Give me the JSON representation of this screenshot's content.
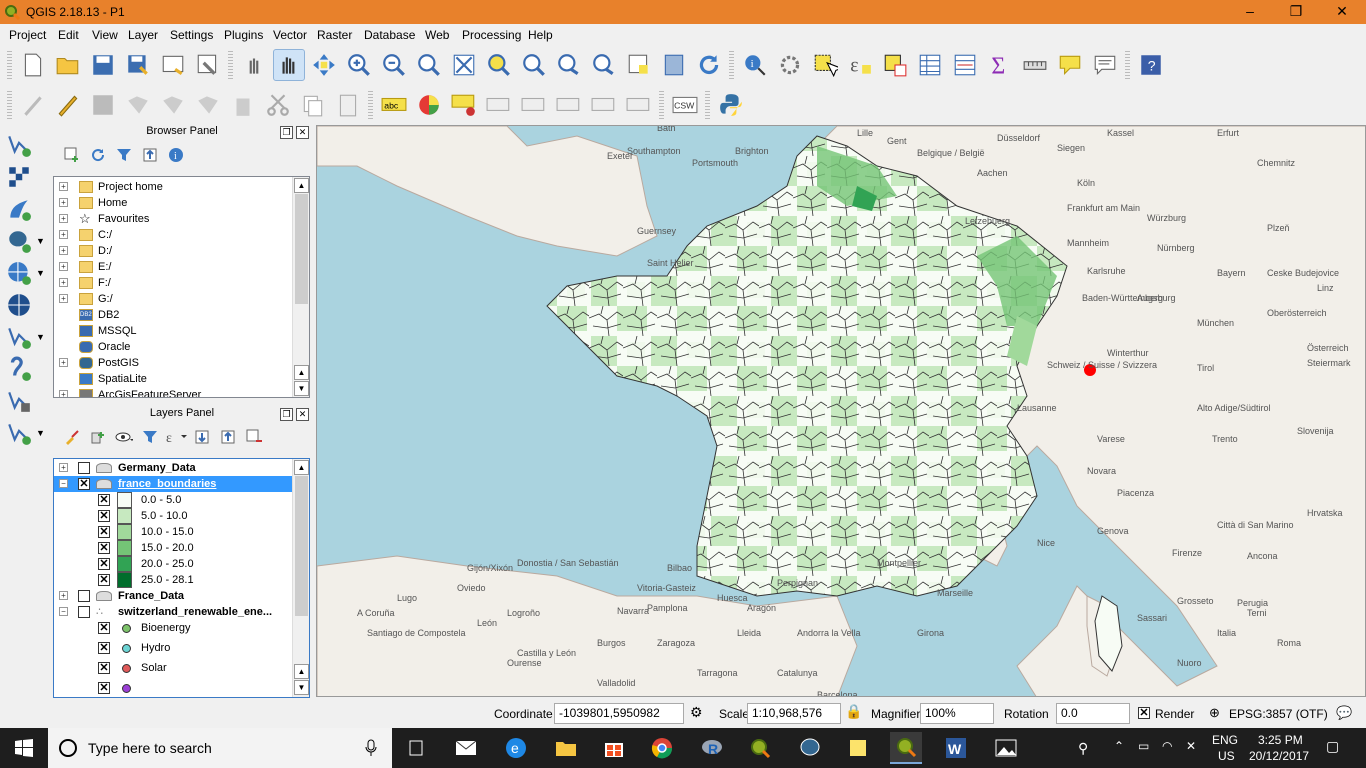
{
  "window": {
    "title": "QGIS 2.18.13 - P1",
    "minimize": "–",
    "maximize": "❐",
    "close": "✕"
  },
  "menu": [
    "Project",
    "Edit",
    "View",
    "Layer",
    "Settings",
    "Plugins",
    "Vector",
    "Raster",
    "Database",
    "Web",
    "Processing",
    "Help"
  ],
  "toolbar_row2": {
    "abc_label": "abc",
    "csw_label": "CSW"
  },
  "browser_panel": {
    "title": "Browser Panel",
    "items": [
      {
        "label": "Project home",
        "icon": "folder-icon"
      },
      {
        "label": "Home",
        "icon": "folder-icon"
      },
      {
        "label": "Favourites",
        "icon": "star-icon"
      },
      {
        "label": "C:/",
        "icon": "folder-icon"
      },
      {
        "label": "D:/",
        "icon": "folder-icon"
      },
      {
        "label": "E:/",
        "icon": "folder-icon"
      },
      {
        "label": "F:/",
        "icon": "folder-icon"
      },
      {
        "label": "G:/",
        "icon": "folder-icon"
      },
      {
        "label": "DB2",
        "icon": "db2-icon",
        "badge": "DB2"
      },
      {
        "label": "MSSQL",
        "icon": "mssql-icon"
      },
      {
        "label": "Oracle",
        "icon": "oracle-icon"
      },
      {
        "label": "PostGIS",
        "icon": "postgis-icon"
      },
      {
        "label": "SpatiaLite",
        "icon": "spatialite-icon"
      },
      {
        "label": "ArcGisFeatureServer",
        "icon": "arcgis-icon"
      }
    ]
  },
  "layers_panel": {
    "title": "Layers Panel",
    "layers": [
      {
        "label": "Germany_Data",
        "checked": false,
        "expanded": false
      },
      {
        "label": "france_boundaries",
        "checked": true,
        "expanded": true,
        "selected": true
      },
      {
        "label": "France_Data",
        "checked": false,
        "expanded": false
      },
      {
        "label": "switzerland_renewable_ene...",
        "checked": false,
        "expanded": true
      }
    ],
    "france_classes": [
      {
        "label": "0.0 - 5.0",
        "color": "#f7fcf5"
      },
      {
        "label": "5.0 - 10.0",
        "color": "#c7e9c0"
      },
      {
        "label": "10.0 - 15.0",
        "color": "#a1d99b"
      },
      {
        "label": "15.0 - 20.0",
        "color": "#74c476"
      },
      {
        "label": "20.0 - 25.0",
        "color": "#31a354"
      },
      {
        "label": "25.0 - 28.1",
        "color": "#006d2c"
      }
    ],
    "swiss_classes": [
      {
        "label": "Bioenergy",
        "color": "#7dc36b"
      },
      {
        "label": "Hydro",
        "color": "#6cd4d4"
      },
      {
        "label": "Solar",
        "color": "#e05a5a"
      },
      {
        "label": "",
        "color": "#9b3fd6"
      }
    ]
  },
  "map": {
    "labels": [
      "Bath",
      "Southampton",
      "Brighton",
      "Portsmouth",
      "Exeter",
      "Guernsey",
      "Saint Helier",
      "Lille",
      "Gent",
      "Belgique / België",
      "Düsseldorf",
      "Siegen",
      "Kassel",
      "Erfurt",
      "Chemnitz",
      "Köln",
      "Aachen",
      "Frankfurt am Main",
      "Würzburg",
      "Plzeň",
      "Letzebuerg",
      "Mannheim",
      "Nürnberg",
      "Karlsruhe",
      "Baden-Württemberg",
      "Augsburg",
      "Bayern",
      "Ceske Budejovice",
      "Oberösterreich",
      "München",
      "Linz",
      "Österreich",
      "Winterthur",
      "Schweiz / Suisse / Svizzera",
      "Lausanne",
      "Tirol",
      "Steiermark",
      "Alto Adige/Südtirol",
      "Varese",
      "Trento",
      "Slovenija",
      "Novara",
      "Piacenza",
      "Hrvatska",
      "Genova",
      "Città di San Marino",
      "Ancona",
      "Firenze",
      "Perugia",
      "Italia",
      "Roma",
      "Terni",
      "Grosseto",
      "Nice",
      "Marseille",
      "Montpellier",
      "Perpignan",
      "Andorra la Vella",
      "Barcelona",
      "Girona",
      "Lleida",
      "Tarragona",
      "Catalunya",
      "Zaragoza",
      "Aragón",
      "Huesca",
      "Logroño",
      "Navarra",
      "Pamplona",
      "Vitoria-Gasteiz",
      "Bilbao",
      "Donostia / San Sebastián",
      "Gijón/Xixón",
      "Oviedo",
      "Lugo",
      "A Coruña",
      "Santiago de Compostela",
      "Ourense",
      "León",
      "Castilla y León",
      "Burgos",
      "Valladolid",
      "Sassari",
      "Nuoro"
    ],
    "marker_color": "#ff0000"
  },
  "status": {
    "coordinate_label": "Coordinate",
    "coordinate_value": "-1039801,5950982",
    "scale_label": "Scale",
    "scale_value": "1:10,968,576",
    "magnifier_label": "Magnifier",
    "magnifier_value": "100%",
    "rotation_label": "Rotation",
    "rotation_value": "0.0",
    "render_label": "Render",
    "crs_label": "EPSG:3857 (OTF)"
  },
  "taskbar": {
    "search_placeholder": "Type here to search",
    "language": "ENG",
    "region": "US",
    "time": "3:25 PM",
    "date": "20/12/2017"
  }
}
